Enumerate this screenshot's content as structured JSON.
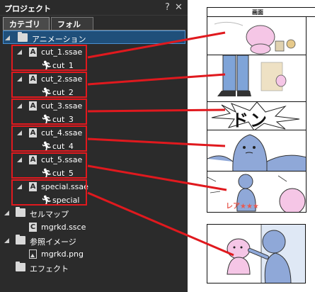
{
  "panel": {
    "title": "プロジェクト",
    "help_label": "?",
    "close_label": "✕",
    "tabs": [
      {
        "label": "カテゴリ"
      },
      {
        "label": "フォルダ"
      }
    ]
  },
  "tree": {
    "animation": "アニメーション",
    "items": [
      {
        "file": "cut_1.ssae",
        "anim": "cut_1"
      },
      {
        "file": "cut_2.ssae",
        "anim": "cut_2"
      },
      {
        "file": "cut_3.ssae",
        "anim": "cut_3"
      },
      {
        "file": "cut_4.ssae",
        "anim": "cut_4"
      },
      {
        "file": "cut_5.ssae",
        "anim": "cut_5"
      },
      {
        "file": "special.ssae",
        "anim": "special"
      }
    ],
    "cellmap": "セルマップ",
    "cellmap_file": "mgrkd.ssce",
    "reference": "参照イメージ",
    "reference_file": "mgrkd.png",
    "effect": "エフェクト"
  },
  "storyboard": {
    "header": "画面",
    "sfx_text": "ドン",
    "rare_text": "レア★★★"
  },
  "colors": {
    "panel_bg": "#2b2b2b",
    "highlight": "#e0191e",
    "selection": "#1f4f7a"
  }
}
